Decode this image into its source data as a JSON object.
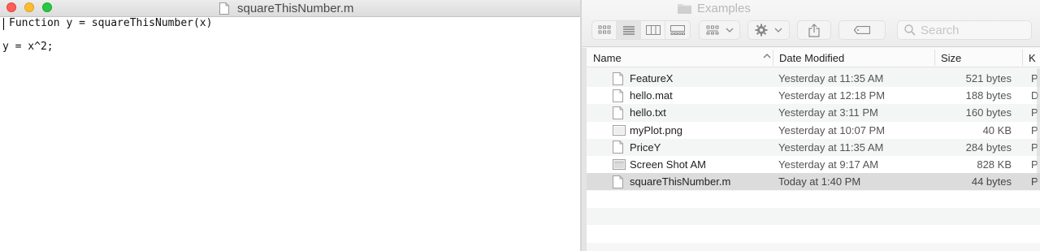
{
  "editor": {
    "title": "squareThisNumber.m",
    "lines": [
      "Function y = squareThisNumber(x)",
      "y = x^2;"
    ]
  },
  "finder": {
    "title": "Examples",
    "search_placeholder": "Search",
    "columns": {
      "name": "Name",
      "date": "Date Modified",
      "size": "Size",
      "kind": "K"
    },
    "files": [
      {
        "name": "FeatureX",
        "date": "Yesterday at 11:35 AM",
        "size": "521 bytes",
        "kind": "P",
        "icon": "document-icon"
      },
      {
        "name": "hello.mat",
        "date": "Yesterday at 12:18 PM",
        "size": "188 bytes",
        "kind": "D",
        "icon": "document-icon"
      },
      {
        "name": "hello.txt",
        "date": "Yesterday at 3:11 PM",
        "size": "160 bytes",
        "kind": "P",
        "icon": "document-icon"
      },
      {
        "name": "myPlot.png",
        "date": "Yesterday at 10:07 PM",
        "size": "40 KB",
        "kind": "P",
        "icon": "image-icon"
      },
      {
        "name": "PriceY",
        "date": "Yesterday at 11:35 AM",
        "size": "284 bytes",
        "kind": "P",
        "icon": "document-icon"
      },
      {
        "name": "Screen Shot AM",
        "date": "Yesterday at 9:17 AM",
        "size": "828 KB",
        "kind": "P",
        "icon": "screenshot-icon"
      },
      {
        "name": "squareThisNumber.m",
        "date": "Today at 1:40 PM",
        "size": "44 bytes",
        "kind": "P",
        "icon": "document-icon"
      }
    ],
    "selected_index": 6
  }
}
